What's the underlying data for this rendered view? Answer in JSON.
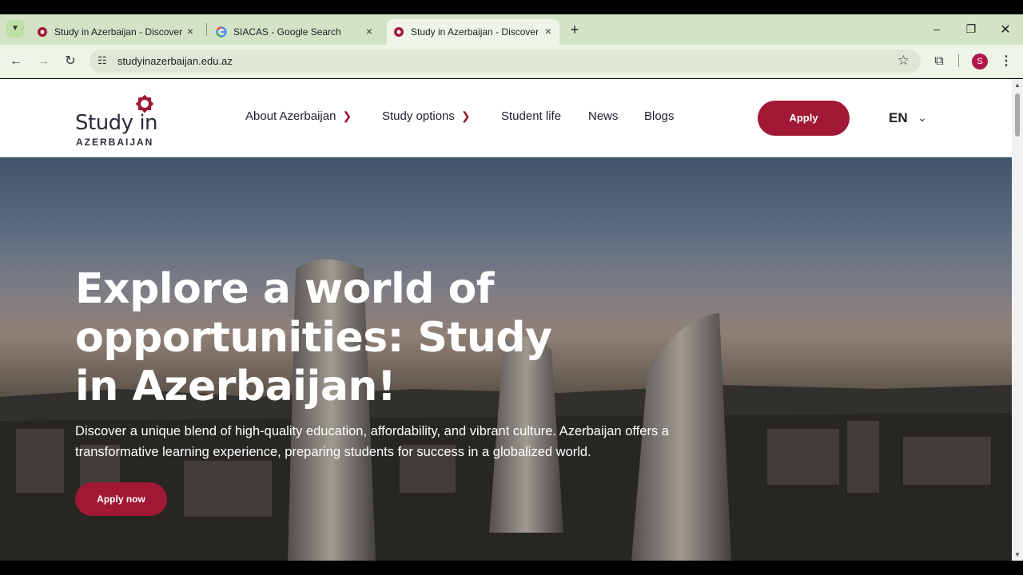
{
  "browser": {
    "tabs": [
      {
        "title": "Study in Azerbaijan - Discover Y",
        "active": false
      },
      {
        "title": "SIACAS - Google Search",
        "active": false
      },
      {
        "title": "Study in Azerbaijan - Discover Y",
        "active": true
      }
    ],
    "new_tab": "+",
    "url": "studyinazerbaijan.edu.az",
    "profile_initial": "S"
  },
  "site": {
    "logo_line1": "Study in",
    "logo_line2": "AZERBAIJAN",
    "nav": [
      {
        "label": "About Azerbaijan",
        "dropdown": true
      },
      {
        "label": "Study options",
        "dropdown": true
      },
      {
        "label": "Student life",
        "dropdown": false
      },
      {
        "label": "News",
        "dropdown": false
      },
      {
        "label": "Blogs",
        "dropdown": false
      }
    ],
    "apply_label": "Apply",
    "language": "EN",
    "brand_color": "#a01834"
  },
  "hero": {
    "title": "Explore a world of opportunities: Study in Azerbaijan!",
    "description": "Discover a unique blend of high-quality education, affordability, and vibrant culture. Azerbaijan offers a transformative learning experience, preparing students for success in a globalized world.",
    "cta_label": "Apply now"
  }
}
